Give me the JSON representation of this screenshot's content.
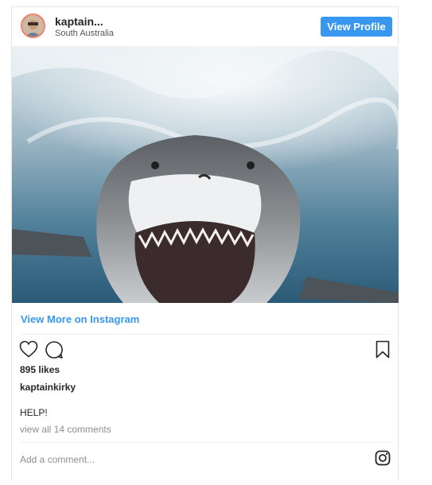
{
  "header": {
    "username": "kaptain...",
    "location": "South Australia",
    "view_profile_label": "View Profile"
  },
  "post": {
    "image_subject": "great white shark underwater",
    "view_more_label": "View More on Instagram",
    "likes": "895 likes",
    "owner": "kaptainkirky",
    "caption": "HELP!",
    "comments_link": "view all 14 comments",
    "add_comment_placeholder": "Add a comment..."
  },
  "icons": [
    "heart-icon",
    "comment-icon",
    "bookmark-icon",
    "instagram-icon"
  ],
  "colors": {
    "accent": "#3897f0",
    "text": "#262626",
    "muted": "#8e8e8e",
    "border": "#e6e6e6"
  }
}
